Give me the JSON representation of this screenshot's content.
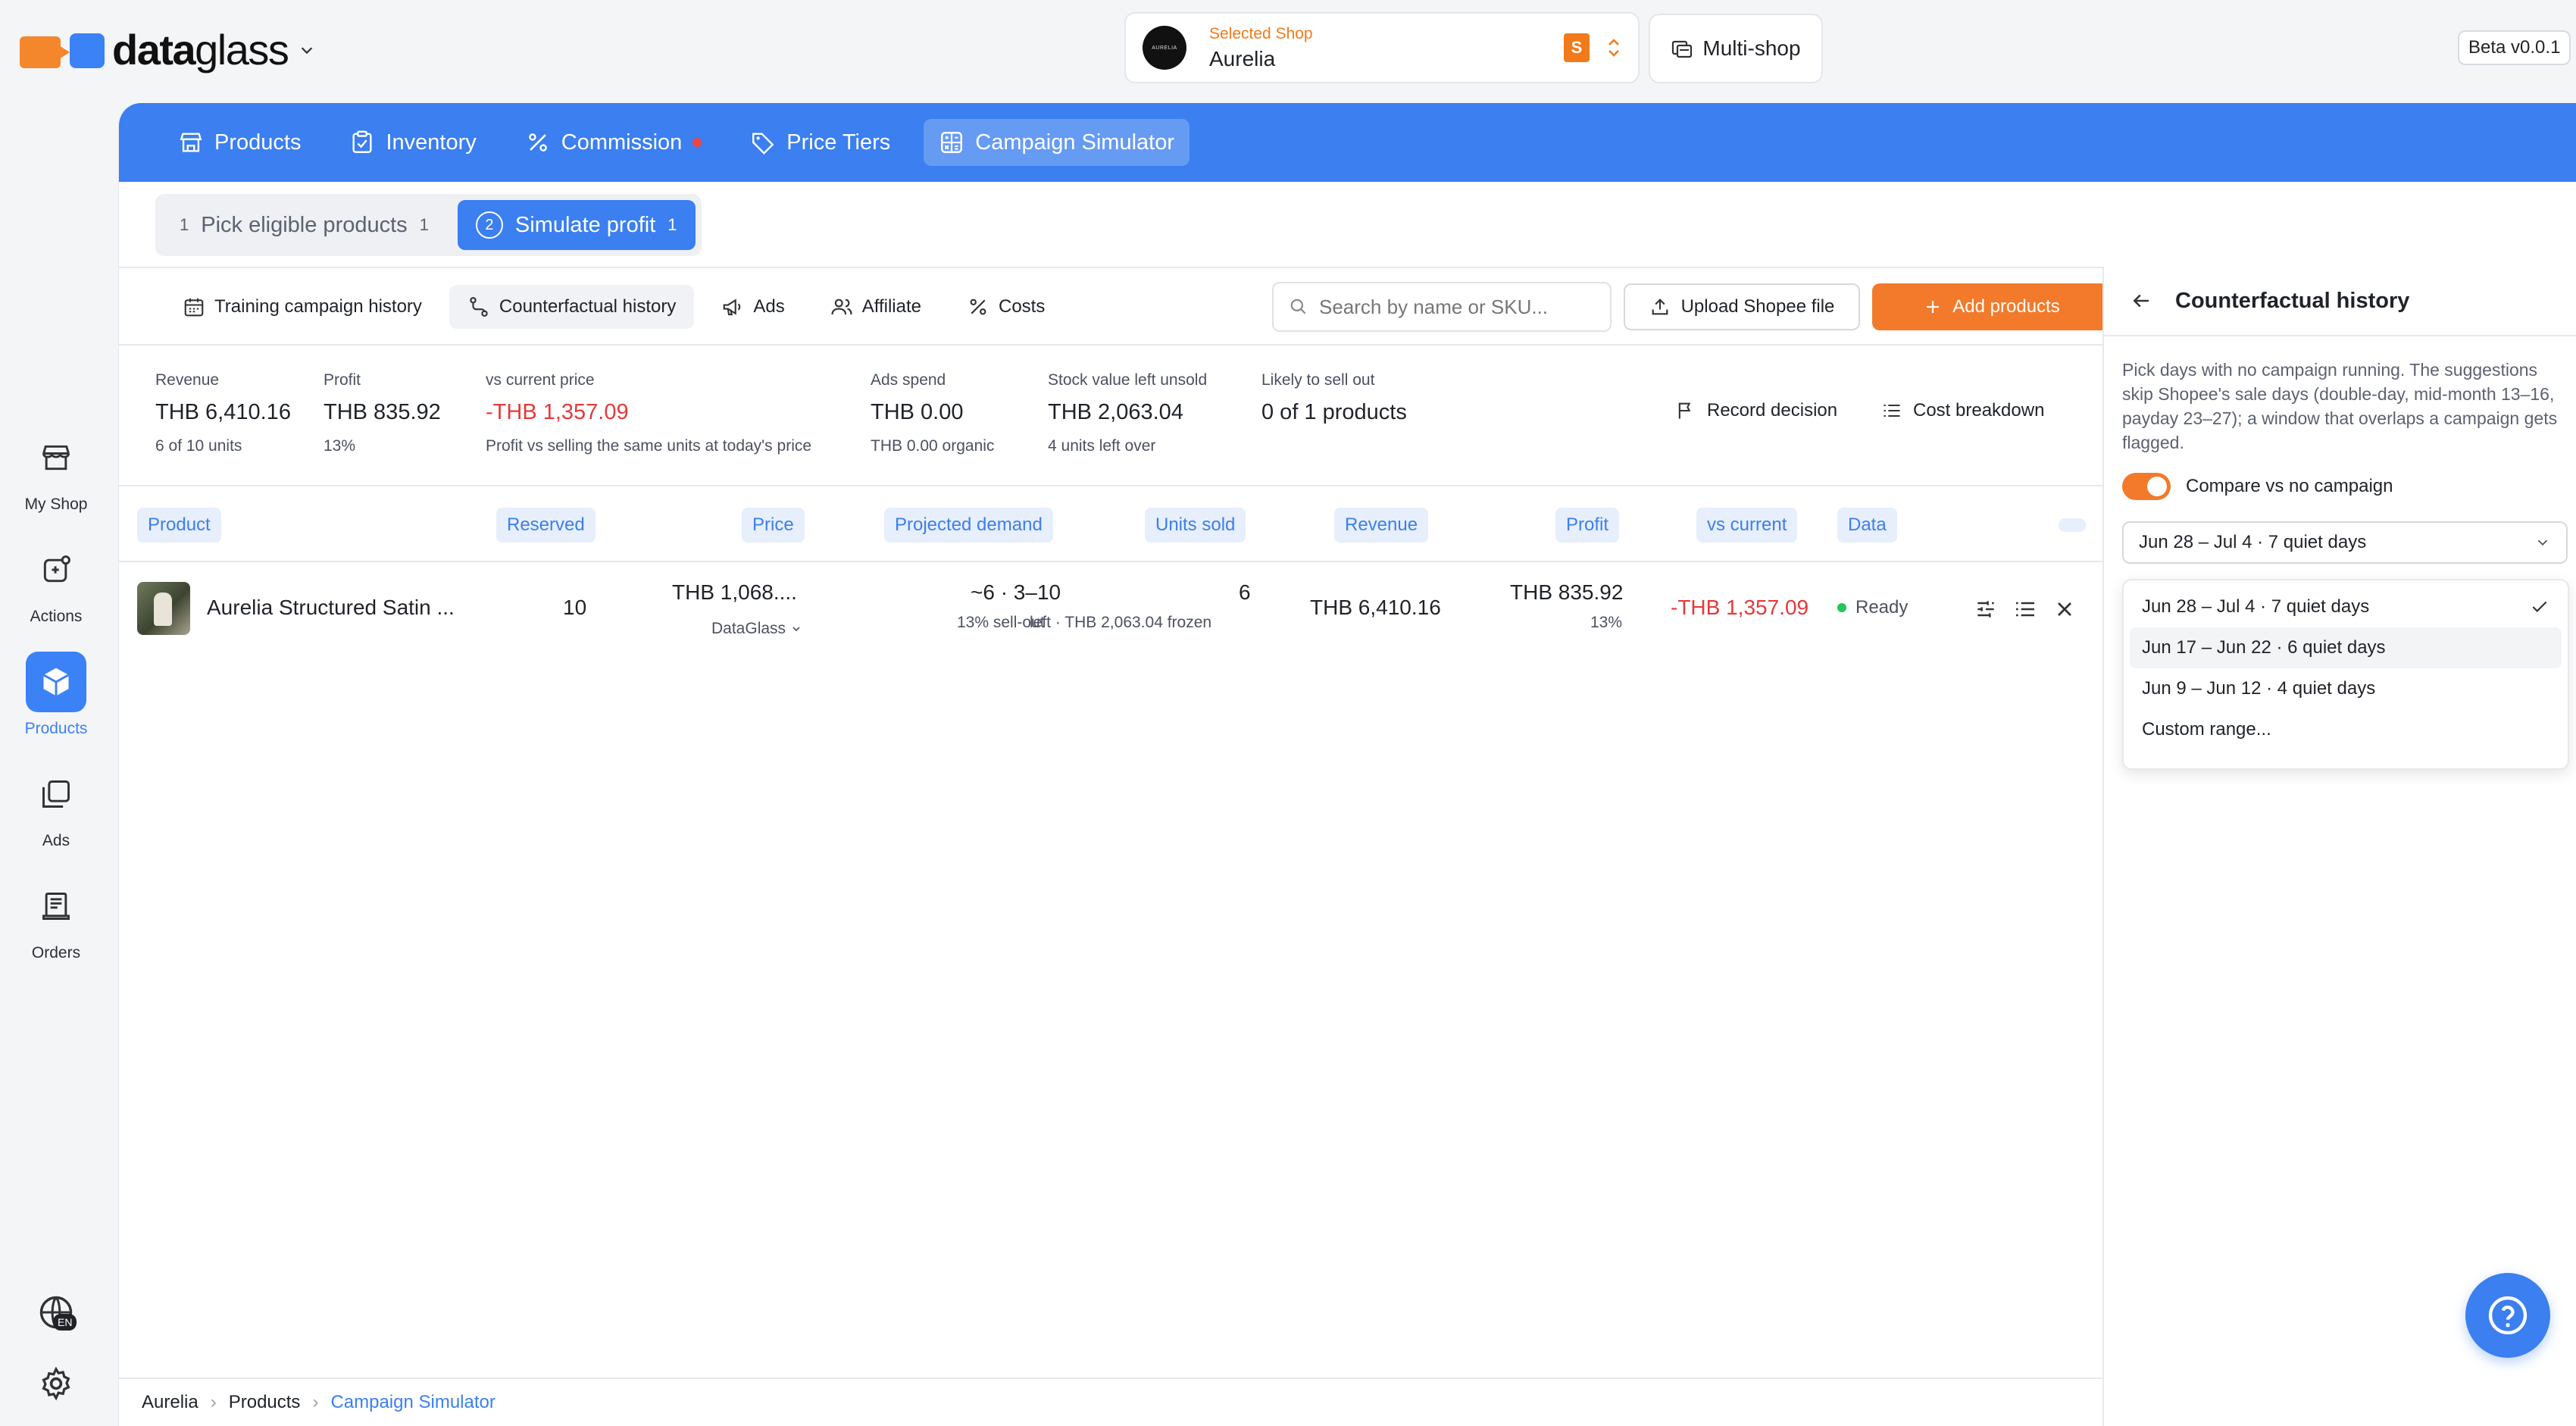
{
  "brand": {
    "name_bold": "data",
    "name_light": "glass"
  },
  "shop": {
    "label": "Selected Shop",
    "name": "Aurelia",
    "avatar_text": "AURELIA",
    "platform_badge": "S"
  },
  "multishop_label": "Multi-shop",
  "beta_label": "Beta v0.0.1",
  "rail": [
    {
      "label": "My Shop",
      "icon": "store-icon"
    },
    {
      "label": "Actions",
      "icon": "actions-icon"
    },
    {
      "label": "Products",
      "icon": "box-icon"
    },
    {
      "label": "Ads",
      "icon": "ads-icon"
    },
    {
      "label": "Orders",
      "icon": "orders-icon"
    }
  ],
  "lang_badge": "EN",
  "nav": [
    {
      "label": "Products",
      "icon": "store-icon"
    },
    {
      "label": "Inventory",
      "icon": "clipboard-icon"
    },
    {
      "label": "Commission",
      "icon": "percent-icon"
    },
    {
      "label": "Price Tiers",
      "icon": "tag-icon"
    },
    {
      "label": "Campaign Simulator",
      "icon": "calculator-icon"
    }
  ],
  "steps": [
    {
      "num": "1",
      "label": "Pick eligible products",
      "count": "1"
    },
    {
      "num": "2",
      "label": "Simulate profit",
      "count": "1"
    }
  ],
  "subtabs": [
    {
      "label": "Training campaign history",
      "icon": "calendar-icon"
    },
    {
      "label": "Counterfactual history",
      "icon": "route-icon"
    },
    {
      "label": "Ads",
      "icon": "megaphone-icon"
    },
    {
      "label": "Affiliate",
      "icon": "users-icon"
    },
    {
      "label": "Costs",
      "icon": "percent-icon"
    }
  ],
  "search": {
    "placeholder": "Search by name or SKU..."
  },
  "upload_label": "Upload Shopee file",
  "add_label": "Add products",
  "metrics": [
    {
      "label": "Revenue",
      "value": "THB 6,410.16",
      "sub": "6 of 10 units"
    },
    {
      "label": "Profit",
      "value": "THB 835.92",
      "sub": "13%"
    },
    {
      "label": "vs current price",
      "value": "-THB 1,357.09",
      "sub": "Profit vs selling the same units at today's price"
    },
    {
      "label": "Ads spend",
      "value": "THB 0.00",
      "sub": "THB 0.00 organic"
    },
    {
      "label": "Stock value left unsold",
      "value": "THB 2,063.04",
      "sub": "4 units left over"
    },
    {
      "label": "Likely to sell out",
      "value": "0 of 1 products",
      "sub": ""
    }
  ],
  "record_label": "Record decision",
  "cost_breakdown_label": "Cost breakdown",
  "columns": [
    "Product",
    "Reserved",
    "Price",
    "Projected demand",
    "Units sold",
    "Revenue",
    "Profit",
    "vs current",
    "Data"
  ],
  "row": {
    "product": "Aurelia Structured Satin ...",
    "reserved": "10",
    "price": "THB 1,068....",
    "price_source": "DataGlass",
    "demand": "~6 · 3–10",
    "demand_sub": "13% sell-out",
    "units_sold": "6",
    "units_sub": "left · THB 2,063.04 frozen",
    "revenue": "THB 6,410.16",
    "profit": "THB 835.92",
    "profit_pct": "13%",
    "vs_current": "-THB 1,357.09",
    "status": "Ready"
  },
  "side": {
    "title": "Counterfactual history",
    "description": "Pick days with no campaign running. The suggestions skip Shopee's sale days (double-day, mid-month 13–16, payday 23–27); a window that overlaps a campaign gets flagged.",
    "toggle_label": "Compare vs no campaign",
    "toggle_on": true,
    "selected": "Jun 28 – Jul 4 · 7 quiet days",
    "options": [
      "Jun 28 – Jul 4 · 7 quiet days",
      "Jun 17 – Jun 22 · 6 quiet days",
      "Jun 9 – Jun 12 · 4 quiet days",
      "Custom range..."
    ]
  },
  "breadcrumb": [
    "Aurelia",
    "Products",
    "Campaign Simulator"
  ],
  "colors": {
    "accent": "#3b7ff0",
    "orange": "#f27a2a",
    "negative": "#e5393a",
    "ready": "#22c55e"
  }
}
